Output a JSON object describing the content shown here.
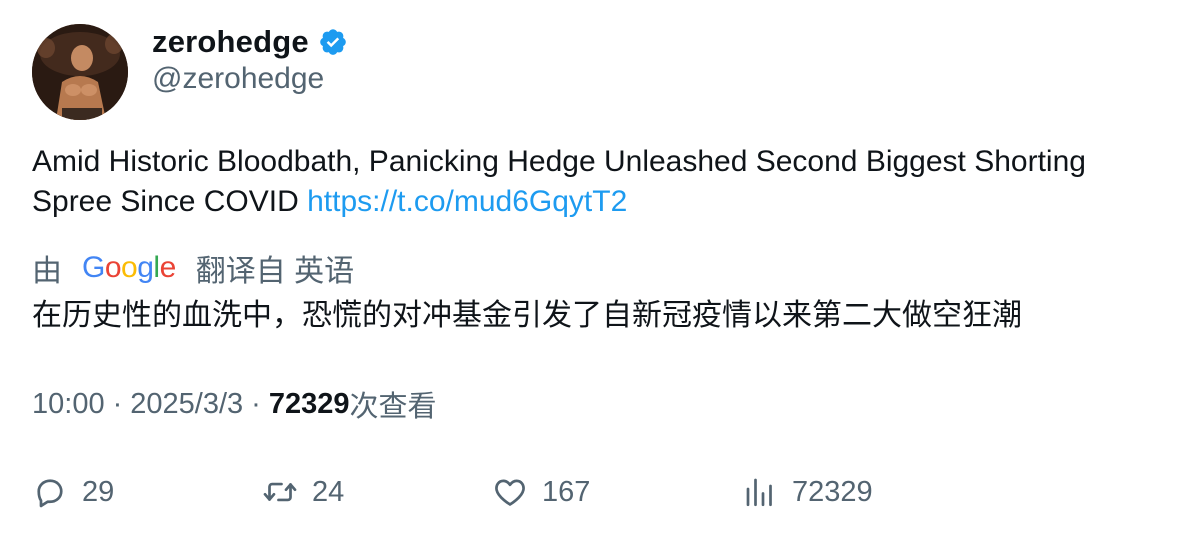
{
  "author": {
    "display_name": "zerohedge",
    "handle": "@zerohedge",
    "verified": true
  },
  "tweet": {
    "text": "Amid Historic Bloodbath, Panicking Hedge Unleashed Second Biggest Shorting Spree Since COVID ",
    "link": "https://t.co/mud6GqytT2"
  },
  "translation": {
    "prefix": "由",
    "provider_letters": [
      "G",
      "o",
      "o",
      "g",
      "l",
      "e"
    ],
    "suffix": "翻译自 英语",
    "text": "在历史性的血洗中，恐慌的对冲基金引发了自新冠疫情以来第二大做空狂潮"
  },
  "meta": {
    "time": "10:00",
    "separator": "·",
    "date": "2025/3/3",
    "views_count": "72329",
    "views_label": "次查看"
  },
  "actions": {
    "replies": "29",
    "retweets": "24",
    "likes": "167",
    "views": "72329"
  },
  "colors": {
    "link": "#1d9bf0",
    "verified": "#1d9bf0",
    "secondary_text": "#536471",
    "primary_text": "#0f1419",
    "google_blue": "#4285F4",
    "google_red": "#EA4335",
    "google_yellow": "#FBBC05",
    "google_green": "#34A853"
  },
  "icons": {
    "reply": "reply-icon",
    "retweet": "retweet-icon",
    "like": "heart-icon",
    "views": "bar-chart-icon",
    "verified": "verified-badge-icon"
  }
}
